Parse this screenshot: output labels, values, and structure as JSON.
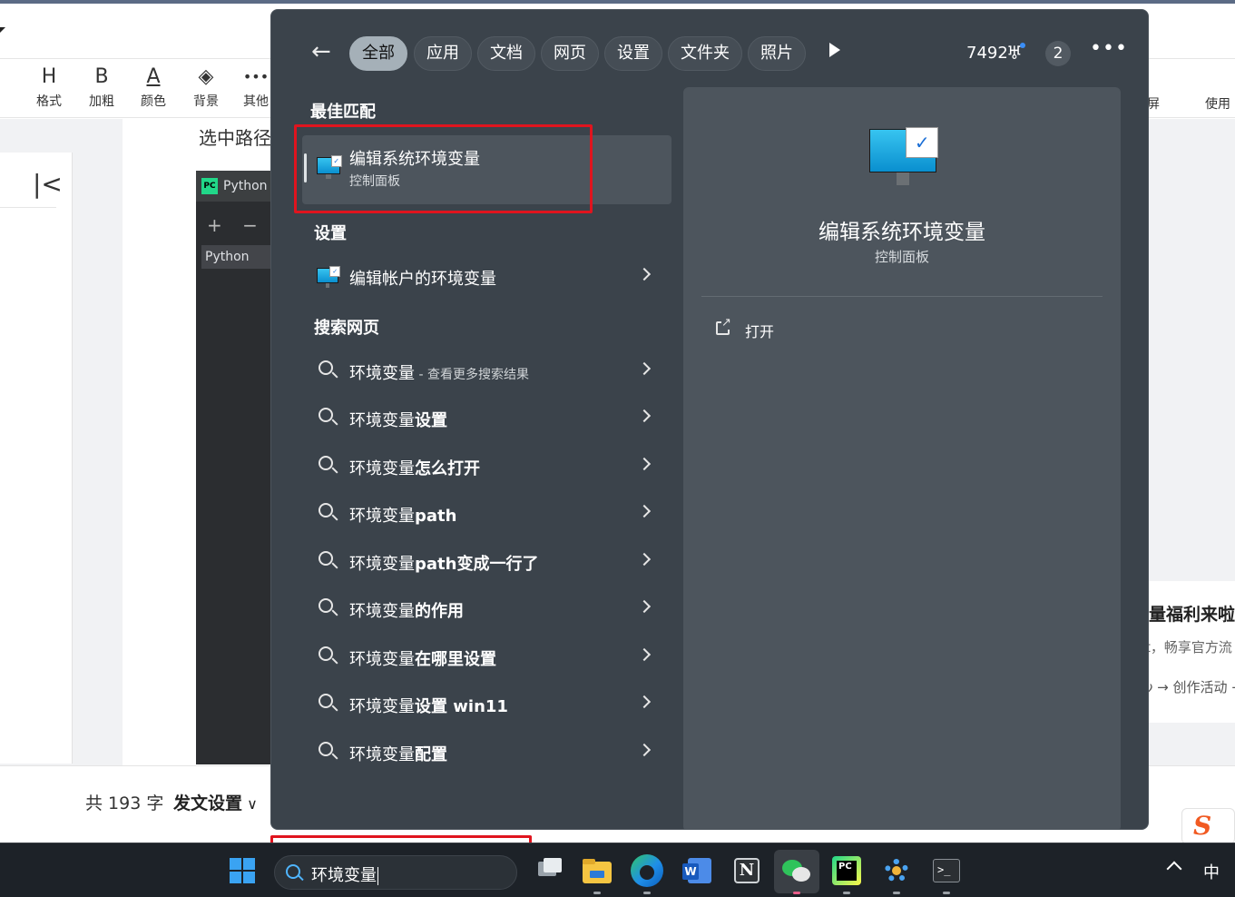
{
  "editor": {
    "toolbar": [
      {
        "icon": "H",
        "label": "格式"
      },
      {
        "icon": "B",
        "label": "加粗"
      },
      {
        "icon": "A",
        "label": "颜色"
      },
      {
        "icon": "◈",
        "label": "背景"
      },
      {
        "icon": "•••",
        "label": "其他"
      }
    ],
    "toolbar_right": {
      "fullscreen_partial": "屏",
      "usage_partial": "使用"
    },
    "content_line_partial": "选中路径",
    "ide": {
      "title_partial": "Python",
      "tools": "+ − ⊘",
      "item_partial": "Python"
    },
    "promo": {
      "title_partial": "量福利来啦",
      "sub_partial": "t，畅享官方流",
      "link_partial": "ν → 创作活动 →"
    },
    "word_count": "共 193 字",
    "publish_settings": "发文设置",
    "sogou_label": "S"
  },
  "search": {
    "filters": [
      "全部",
      "应用",
      "文档",
      "网页",
      "设置",
      "文件夹",
      "照片"
    ],
    "active_filter": "全部",
    "points": "7492",
    "notification_count": "2",
    "more_label": "•••",
    "sections": {
      "best_match": "最佳匹配",
      "settings": "设置",
      "web": "搜索网页"
    },
    "best_match": {
      "title": "编辑系统环境变量",
      "subtitle": "控制面板"
    },
    "settings_item": {
      "title": "编辑帐户的环境变量"
    },
    "web_results": [
      {
        "prefix": "环境变量",
        "suffix": "",
        "dim": " - 查看更多搜索结果"
      },
      {
        "prefix": "环境变量",
        "suffix": "设置",
        "dim": ""
      },
      {
        "prefix": "环境变量",
        "suffix": "怎么打开",
        "dim": ""
      },
      {
        "prefix": "环境变量",
        "suffix": "path",
        "dim": ""
      },
      {
        "prefix": "环境变量",
        "suffix": "path变成一行了",
        "dim": ""
      },
      {
        "prefix": "环境变量",
        "suffix": "的作用",
        "dim": ""
      },
      {
        "prefix": "环境变量",
        "suffix": "在哪里设置",
        "dim": ""
      },
      {
        "prefix": "环境变量",
        "suffix": "设置 win11",
        "dim": ""
      },
      {
        "prefix": "环境变量",
        "suffix": "配置",
        "dim": ""
      }
    ],
    "preview": {
      "title": "编辑系统环境变量",
      "subtitle": "控制面板",
      "action": "打开"
    }
  },
  "taskbar": {
    "search_text": "环境变量",
    "apps": [
      "task-view",
      "file-explorer",
      "edge",
      "word",
      "notion",
      "wechat",
      "pycharm",
      "settings",
      "terminal"
    ],
    "tray_ime": "中"
  },
  "colors": {
    "panel_bg": "#3b434b",
    "card_bg": "#4d555d",
    "active_pill": "#a5b0b8",
    "annotation_red": "#e0141e",
    "taskbar_bg": "#1d2228"
  }
}
